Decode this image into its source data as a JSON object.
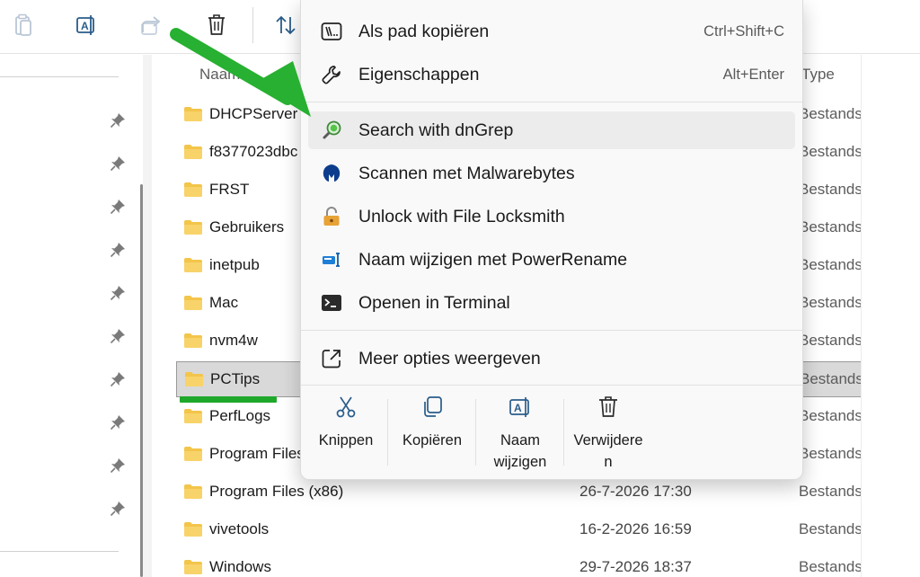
{
  "columns": {
    "name": "Naam",
    "type": "Type"
  },
  "files": [
    {
      "name": "DHCPServer",
      "date": "",
      "type": "Bestands"
    },
    {
      "name": "f8377023dbc",
      "date": "",
      "type": "Bestands"
    },
    {
      "name": "FRST",
      "date": "",
      "type": "Bestands"
    },
    {
      "name": "Gebruikers",
      "date": "",
      "type": "Bestands"
    },
    {
      "name": "inetpub",
      "date": "",
      "type": "Bestands"
    },
    {
      "name": "Mac",
      "date": "",
      "type": "Bestands"
    },
    {
      "name": "nvm4w",
      "date": "",
      "type": "Bestands"
    },
    {
      "name": "PCTips",
      "date": "",
      "type": "Bestands"
    },
    {
      "name": "PerfLogs",
      "date": "",
      "type": "Bestands"
    },
    {
      "name": "Program Files",
      "date": "",
      "type": "Bestands"
    },
    {
      "name": "Program Files (x86)",
      "date": "26-7-2026 17:30",
      "type": "Bestands"
    },
    {
      "name": "vivetools",
      "date": "16-2-2026 16:59",
      "type": "Bestands"
    },
    {
      "name": "Windows",
      "date": "29-7-2026 18:37",
      "type": "Bestands"
    }
  ],
  "menu": {
    "items": [
      {
        "label": "Als pad kopiëren",
        "shortcut": "Ctrl+Shift+C",
        "icon": "copy-path-icon"
      },
      {
        "label": "Eigenschappen",
        "shortcut": "Alt+Enter",
        "icon": "wrench-icon"
      },
      {
        "label": "Search with dnGrep",
        "shortcut": "",
        "icon": "dngrep-icon"
      },
      {
        "label": "Scannen met Malwarebytes",
        "shortcut": "",
        "icon": "malwarebytes-icon"
      },
      {
        "label": "Unlock with File Locksmith",
        "shortcut": "",
        "icon": "lock-icon"
      },
      {
        "label": "Naam wijzigen met PowerRename",
        "shortcut": "",
        "icon": "powerrename-icon"
      },
      {
        "label": "Openen in Terminal",
        "shortcut": "",
        "icon": "terminal-icon"
      },
      {
        "label": "Meer opties weergeven",
        "shortcut": "",
        "icon": "external-icon"
      }
    ],
    "quick_actions": [
      {
        "line1": "Knippen",
        "line2": "",
        "icon": "scissors-icon"
      },
      {
        "line1": "Kopiëren",
        "line2": "",
        "icon": "copy-icon"
      },
      {
        "line1": "Naam",
        "line2": "wijzigen",
        "icon": "rename-icon"
      },
      {
        "line1": "Verwijdere",
        "line2": "n",
        "icon": "trash-icon"
      }
    ]
  },
  "colors": {
    "accent_green": "#1fa82b",
    "folder_yellow": "#f3c54a",
    "selection": "#d9d9d9"
  },
  "selected_file": "PCTips",
  "hovered_menu_item": "Search with dnGrep"
}
